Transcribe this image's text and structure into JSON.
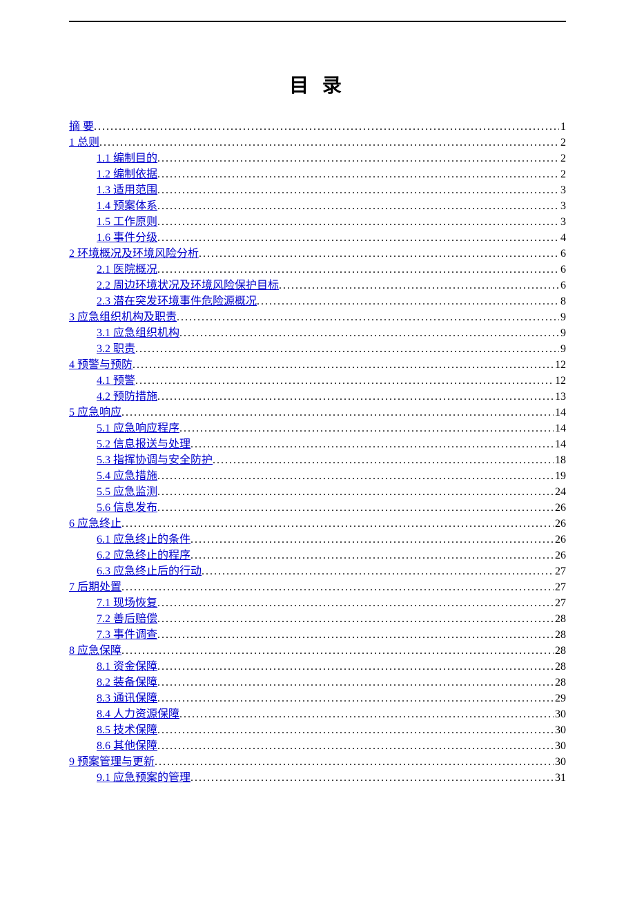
{
  "title": "目  录",
  "toc": [
    {
      "level": 1,
      "text": "摘  要",
      "page": "1"
    },
    {
      "level": 1,
      "text": "1 总则",
      "page": "2"
    },
    {
      "level": 2,
      "text": "1.1 编制目的",
      "page": "2"
    },
    {
      "level": 2,
      "text": "1.2 编制依据",
      "page": "2"
    },
    {
      "level": 2,
      "text": "1.3 适用范围",
      "page": "3"
    },
    {
      "level": 2,
      "text": "1.4 预案体系",
      "page": "3"
    },
    {
      "level": 2,
      "text": "1.5 工作原则",
      "page": "3"
    },
    {
      "level": 2,
      "text": "1.6 事件分级",
      "page": "4"
    },
    {
      "level": 1,
      "text": "2 环境概况及环境风险分析",
      "page": "6"
    },
    {
      "level": 2,
      "text": "2.1 医院概况",
      "page": "6"
    },
    {
      "level": 2,
      "text": "2.2 周边环境状况及环境风险保护目标",
      "page": "6"
    },
    {
      "level": 2,
      "text": "2.3 潜在突发环境事件危险源概况",
      "page": "8"
    },
    {
      "level": 1,
      "text": "3 应急组织机构及职责",
      "page": "9"
    },
    {
      "level": 2,
      "text": "3.1 应急组织机构",
      "page": "9"
    },
    {
      "level": 2,
      "text": "3.2 职责",
      "page": "9"
    },
    {
      "level": 1,
      "text": "4 预警与预防",
      "page": "12"
    },
    {
      "level": 2,
      "text": "4.1 预警",
      "page": "12"
    },
    {
      "level": 2,
      "text": "4.2 预防措施",
      "page": "13"
    },
    {
      "level": 1,
      "text": "5 应急响应",
      "page": "14"
    },
    {
      "level": 2,
      "text": "5.1 应急响应程序",
      "page": "14"
    },
    {
      "level": 2,
      "text": "5.2 信息报送与处理",
      "page": "14"
    },
    {
      "level": 2,
      "text": "5.3 指挥协调与安全防护",
      "page": "18"
    },
    {
      "level": 2,
      "text": "5.4 应急措施",
      "page": "19"
    },
    {
      "level": 2,
      "text": "5.5 应急监测",
      "page": "24"
    },
    {
      "level": 2,
      "text": "5.6 信息发布",
      "page": "26"
    },
    {
      "level": 1,
      "text": "6 应急终止",
      "page": "26"
    },
    {
      "level": 2,
      "text": "6.1 应急终止的条件",
      "page": "26"
    },
    {
      "level": 2,
      "text": "6.2 应急终止的程序",
      "page": "26"
    },
    {
      "level": 2,
      "text": "6.3 应急终止后的行动",
      "page": "27"
    },
    {
      "level": 1,
      "text": "7 后期处置",
      "page": "27"
    },
    {
      "level": 2,
      "text": "7.1 现场恢复",
      "page": "27"
    },
    {
      "level": 2,
      "text": "7.2 善后赔偿",
      "page": "28"
    },
    {
      "level": 2,
      "text": "7.3 事件调查",
      "page": "28"
    },
    {
      "level": 1,
      "text": "8 应急保障",
      "page": "28"
    },
    {
      "level": 2,
      "text": "8.1 资金保障",
      "page": "28"
    },
    {
      "level": 2,
      "text": "8.2 装备保障",
      "page": "28"
    },
    {
      "level": 2,
      "text": "8.3 通讯保障",
      "page": "29"
    },
    {
      "level": 2,
      "text": "8.4 人力资源保障",
      "page": "30"
    },
    {
      "level": 2,
      "text": "8.5 技术保障",
      "page": "30"
    },
    {
      "level": 2,
      "text": "8.6 其他保障",
      "page": "30"
    },
    {
      "level": 1,
      "text": "9 预案管理与更新",
      "page": "30"
    },
    {
      "level": 2,
      "text": "9.1 应急预案的管理",
      "page": "31"
    }
  ]
}
